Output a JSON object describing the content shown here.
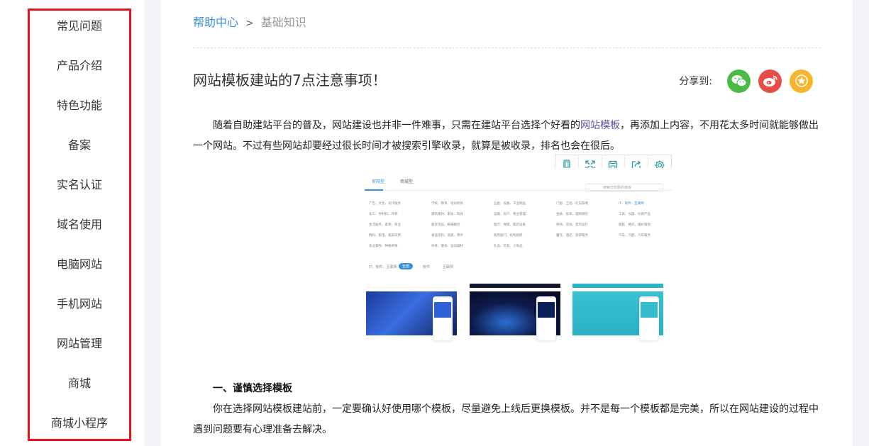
{
  "sidebar": {
    "items": [
      {
        "label": "常见问题"
      },
      {
        "label": "产品介绍"
      },
      {
        "label": "特色功能"
      },
      {
        "label": "备案"
      },
      {
        "label": "实名认证"
      },
      {
        "label": "域名使用"
      },
      {
        "label": "电脑网站"
      },
      {
        "label": "手机网站"
      },
      {
        "label": "网站管理"
      },
      {
        "label": "商城"
      },
      {
        "label": "商城小程序"
      }
    ]
  },
  "breadcrumb": {
    "home": "帮助中心",
    "separator": ">",
    "current": "基础知识"
  },
  "article": {
    "title": "网站模板建站的7点注意事项！",
    "share_label": "分享到:",
    "share_buttons": [
      {
        "icon": "wechat-icon",
        "color": "#4cbb45"
      },
      {
        "icon": "weibo-icon",
        "color": "#e64d47"
      },
      {
        "icon": "star-icon",
        "color": "#f7b52c"
      }
    ],
    "intro_before": "随着自助建站平台的普及，网站建设也并非一件难事，只需在建站平台选择个好看的",
    "intro_link": "网站模板",
    "intro_after": "，再添加上内容，不用花太多时间就能够做出一个网站。不过有些网站却要经过很长时间才被搜索引擎收录，就算是被收录，排名也会在很后。",
    "section1_heading": "一、谨慎选择模板",
    "section1_text": "你在选择网站模板建站前，一定要确认好使用哪个模板，尽量避免上线后更换模板。并不是每一个模板都是完美，所以在网站建设的过程中遇到问题要有心理准备去解决。"
  },
  "image_toolbar": {
    "tools": [
      "mobile-icon",
      "fullscreen-icon",
      "save-icon",
      "share-icon",
      "settings-icon"
    ]
  },
  "embedded_screenshot": {
    "tabs": [
      "官网型",
      "商城型"
    ],
    "search_placeholder": "搜索您想要的模板",
    "categories": [
      "广告、文化、设计服务",
      "学校、教育、培训机构",
      "五金、设备、工业制品",
      "门窗、卫浴、灯光照明",
      "IT、软件、互联网",
      "化工、原材料、环保",
      "建筑建材、家居、科技",
      "运输、房产、物业管理",
      "金融、投资、理财保险",
      "工具、仪器、仪表产品",
      "生活服务、家政、商业",
      "服装饰品、鞋帽箱包",
      "医疗、保健、医药设备",
      "律师、咨询、室内设计",
      "摄影、婚庆、婚纱策划",
      "数码、家电、家居日用",
      "食品饮料、酒类、茶叶",
      "政府部门、机构组织",
      "餐饮、酒店、旅游服务",
      "汽车、汽配、汽车服务",
      "农业畜牧、种植养殖",
      "体育、健身、运动器材",
      "礼品、玩具、小商品"
    ],
    "filters": [
      "IT、软件、互联网",
      "全部",
      "软件",
      "互联网"
    ]
  }
}
